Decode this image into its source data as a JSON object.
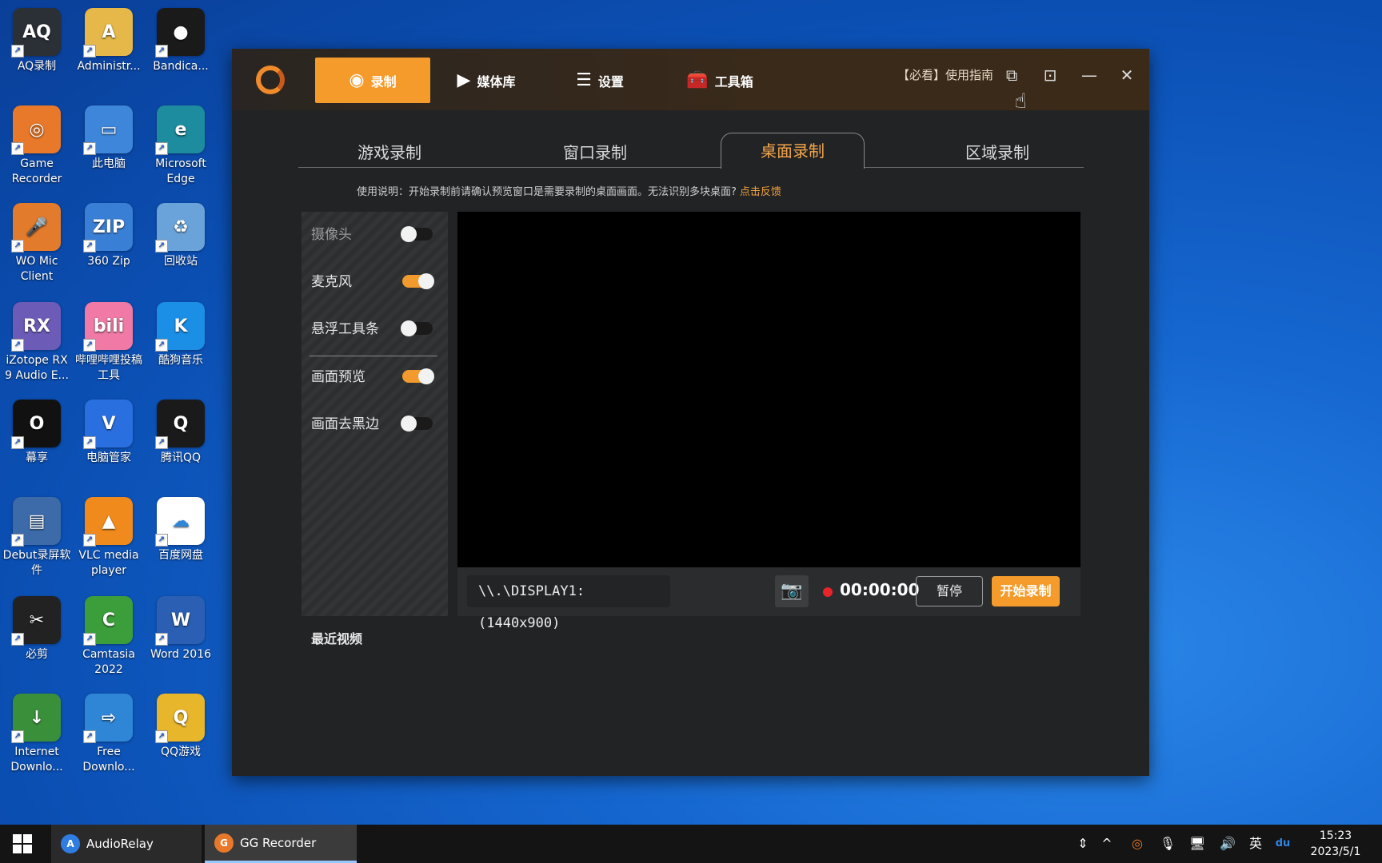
{
  "desktop": {
    "icons": [
      {
        "label": "AQ录制",
        "glyph": "AQ",
        "color": "#2b2f36"
      },
      {
        "label": "Administr...",
        "glyph": "A",
        "color": "#e6b84a"
      },
      {
        "label": "Bandica...",
        "glyph": "●",
        "color": "#1a1a1a"
      },
      {
        "label": "Game Recorder",
        "glyph": "◎",
        "color": "#e8792a"
      },
      {
        "label": "此电脑",
        "glyph": "▭",
        "color": "#3e86d9"
      },
      {
        "label": "Microsoft Edge",
        "glyph": "e",
        "color": "#1c8c9e"
      },
      {
        "label": "WO Mic Client",
        "glyph": "🎤",
        "color": "#e27b2b"
      },
      {
        "label": "360 Zip",
        "glyph": "ZIP",
        "color": "#3a7fd6"
      },
      {
        "label": "回收站",
        "glyph": "♻",
        "color": "#6aa3d9"
      },
      {
        "label": "iZotope RX 9 Audio E...",
        "glyph": "RX",
        "color": "#6d5bb8"
      },
      {
        "label": "哔哩哔哩投稿工具",
        "glyph": "bili",
        "color": "#f07aa5"
      },
      {
        "label": "酷狗音乐",
        "glyph": "K",
        "color": "#1b8fe6"
      },
      {
        "label": "幕享",
        "glyph": "O",
        "color": "#111111"
      },
      {
        "label": "电脑管家",
        "glyph": "V",
        "color": "#2a6fe0"
      },
      {
        "label": "腾讯QQ",
        "glyph": "Q",
        "color": "#1a1a1a"
      },
      {
        "label": "Debut录屏软件",
        "glyph": "▤",
        "color": "#3d6aa8"
      },
      {
        "label": "VLC media player",
        "glyph": "▲",
        "color": "#f08a1c"
      },
      {
        "label": "百度网盘",
        "glyph": "☁",
        "color": "#ffffff"
      },
      {
        "label": "必剪",
        "glyph": "✂",
        "color": "#222222"
      },
      {
        "label": "Camtasia 2022",
        "glyph": "C",
        "color": "#3b9e3b"
      },
      {
        "label": "Word 2016",
        "glyph": "W",
        "color": "#2b5fb3"
      },
      {
        "label": "Internet Downlo...",
        "glyph": "↓",
        "color": "#3a8f3a"
      },
      {
        "label": "Free Downlo...",
        "glyph": "⇨",
        "color": "#2f86d6"
      },
      {
        "label": "QQ游戏",
        "glyph": "Q",
        "color": "#e8b62a"
      }
    ]
  },
  "app": {
    "nav": {
      "record": "录制",
      "media": "媒体库",
      "settings": "设置",
      "toolbox": "工具箱"
    },
    "guide_text": "【必看】使用指南",
    "tabs": [
      "游戏录制",
      "窗口录制",
      "桌面录制",
      "区域录制"
    ],
    "active_tab": "桌面录制",
    "notice": "使用说明：开始录制前请确认预览窗口是需要录制的桌面画面。无法识别多块桌面?",
    "notice_link": "点击反馈",
    "options": [
      {
        "label": "摄像头",
        "on": false,
        "dim": true
      },
      {
        "label": "麦克风",
        "on": true,
        "dim": false
      },
      {
        "label": "悬浮工具条",
        "on": false,
        "dim": false
      },
      {
        "label": "画面预览",
        "on": true,
        "dim": false
      },
      {
        "label": "画面去黑边",
        "on": false,
        "dim": false
      }
    ],
    "display_source": "\\\\.\\DISPLAY1: (1440x900)",
    "timer": "00:00:00",
    "pause_label": "暂停",
    "start_label": "开始录制",
    "recent_label": "最近视频",
    "colors": {
      "accent": "#f59b2b",
      "rec": "#e8232a"
    }
  },
  "taskbar": {
    "items": [
      {
        "label": "AudioRelay",
        "icon_color": "#2f7de0"
      },
      {
        "label": "GG Recorder",
        "icon_color": "#e8792a"
      }
    ],
    "ime": "英",
    "time": "15:23",
    "date": "2023/5/1"
  }
}
